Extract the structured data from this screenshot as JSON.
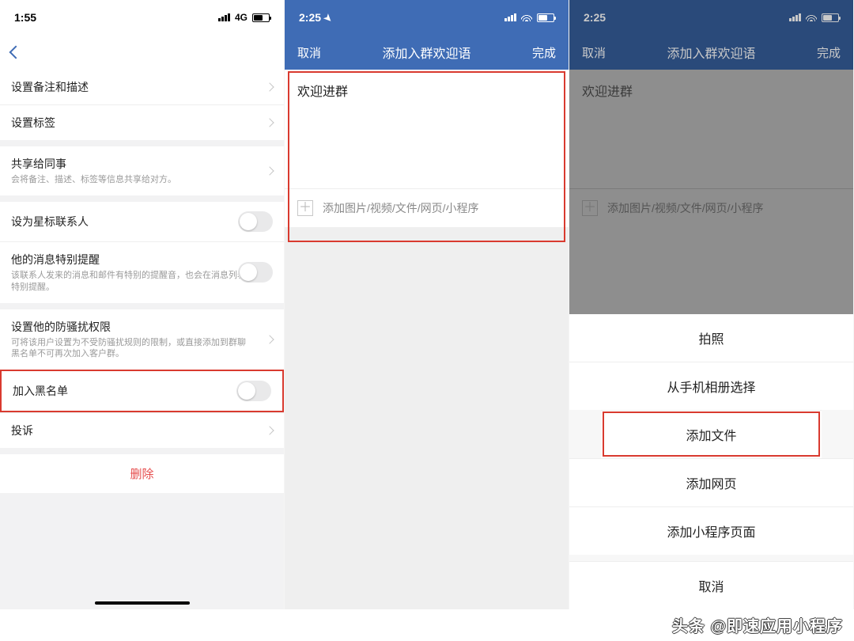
{
  "watermark": "头条 @即速应用小程序",
  "phone1": {
    "time": "1:55",
    "net": "4G",
    "rows": {
      "remark": "设置备注和描述",
      "tags": "设置标签",
      "share": "共享给同事",
      "share_sub": "会将备注、描述、标签等信息共享给对方。",
      "star": "设为星标联系人",
      "alert": "他的消息特别提醒",
      "alert_sub": "该联系人发来的消息和邮件有特别的提醒音，也会在消息列表特别提醒。",
      "antiharass": "设置他的防骚扰权限",
      "antiharass_sub": "可将该用户设置为不受防骚扰规则的限制，或直接添加到群聊黑名单不可再次加入客户群。",
      "blacklist": "加入黑名单",
      "complain": "投诉",
      "delete": "删除"
    }
  },
  "phone2": {
    "time": "2:25",
    "nav": {
      "cancel": "取消",
      "title": "添加入群欢迎语",
      "done": "完成"
    },
    "body_text": "欢迎进群",
    "attach_label": "添加图片/视频/文件/网页/小程序"
  },
  "phone3": {
    "time": "2:25",
    "nav": {
      "cancel": "取消",
      "title": "添加入群欢迎语",
      "done": "完成"
    },
    "body_text": "欢迎进群",
    "attach_label": "添加图片/视频/文件/网页/小程序",
    "sheet": {
      "photo": "拍照",
      "album": "从手机相册选择",
      "file": "添加文件",
      "web": "添加网页",
      "mini": "添加小程序页面",
      "cancel": "取消"
    }
  }
}
